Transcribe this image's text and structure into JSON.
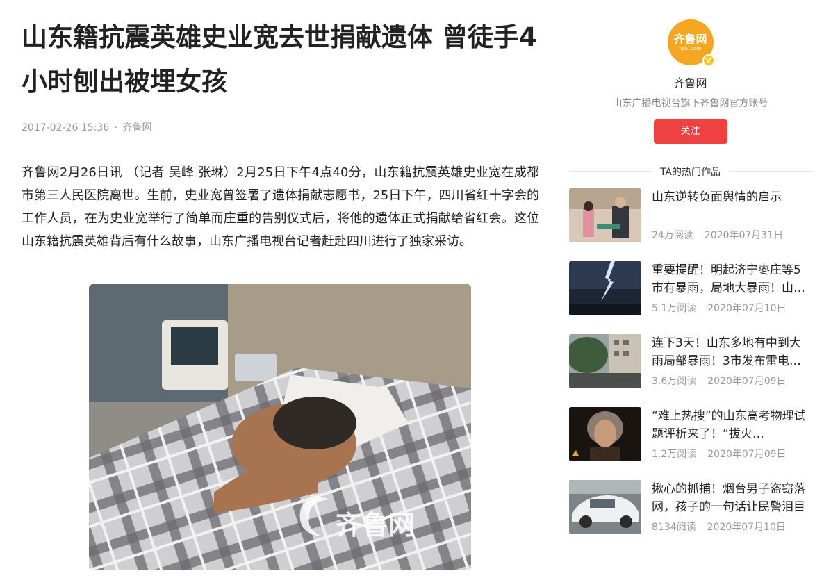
{
  "article": {
    "title": "山东籍抗震英雄史业宽去世捐献遗体 曾徒手4小时刨出被埋女孩",
    "date": "2017-02-26 15:36",
    "separator": "·",
    "source": "齐鲁网",
    "paragraph": "齐鲁网2月26日讯 （记者 吴峰 张琳）2月25日下午4点40分，山东籍抗震英雄史业宽在成都市第三人民医院离世。生前，史业宽曾签署了遗体捐献志愿书，25日下午，四川省红十字会的工作人员，在为史业宽举行了简单而庄重的告别仪式后，将他的遗体正式捐献给省红会。这位山东籍抗震英雄背后有什么故事，山东广播电视台记者赶赴四川进行了独家采访。",
    "image_watermark": "齐鲁网"
  },
  "profile": {
    "avatar_logo_cn": "齐鲁网",
    "avatar_logo_en": "iqilu.com",
    "verified_mark": "V",
    "name": "齐鲁网",
    "description": "山东广播电视台旗下齐鲁网官方账号",
    "follow_label": "关注"
  },
  "hot_section": {
    "heading": "TA的热门作品",
    "items": [
      {
        "title": "山东逆转负面舆情的启示",
        "reads": "24万阅读",
        "date": "2020年07月31日"
      },
      {
        "title": "重要提醒！明起济宁枣庄等5市有暴雨，局地大暴雨！山东…",
        "reads": "5.1万阅读",
        "date": "2020年07月10日"
      },
      {
        "title": "连下3天！山东多地有中到大雨局部暴雨！3市发布雷电…",
        "reads": "3.6万阅读",
        "date": "2020年07月09日"
      },
      {
        "title": "“难上热搜”的山东高考物理试题评析来了！“拔火罐”和“滑…",
        "reads": "1.2万阅读",
        "date": "2020年07月09日"
      },
      {
        "title": "揪心的抓捕！烟台男子盗窃落网，孩子的一句话让民警泪目",
        "reads": "8134阅读",
        "date": "2020年07月10日"
      }
    ]
  }
}
